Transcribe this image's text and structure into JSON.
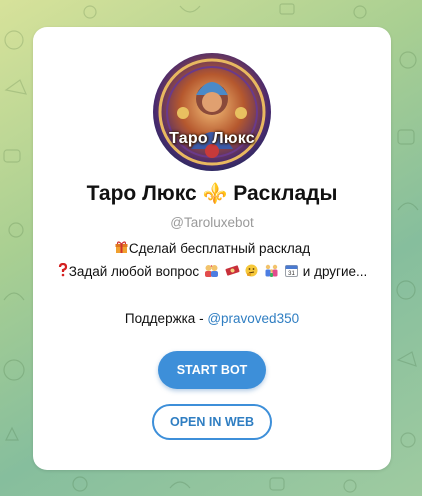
{
  "card": {
    "avatar_text": "Таро Люкс",
    "title_left": "Таро Люкс",
    "title_icon": "⚜️",
    "title_right": "Расклады",
    "username": "@Taroluxebot",
    "desc_line1_icon": "gift-icon",
    "desc_line1": "Сделай бесплатный расклад",
    "desc_line2_icon": "question-mark-icon",
    "desc_line2_text": "Задай любой вопрос",
    "desc_line2_icons": [
      "couple-kiss-icon",
      "cash-icon",
      "thinking-face-icon",
      "family-icon",
      "calendar-icon"
    ],
    "desc_line2_suffix": "и другие...",
    "support_label": "Поддержка - ",
    "support_link": "@pravoved350"
  },
  "buttons": {
    "start_label": "START BOT",
    "web_label": "OPEN IN WEB"
  },
  "colors": {
    "accent": "#3d8fd9",
    "link": "#2f7ec2",
    "muted": "#9a9a9a",
    "background_gradient": [
      "#d7e29a",
      "#86be9d"
    ]
  }
}
